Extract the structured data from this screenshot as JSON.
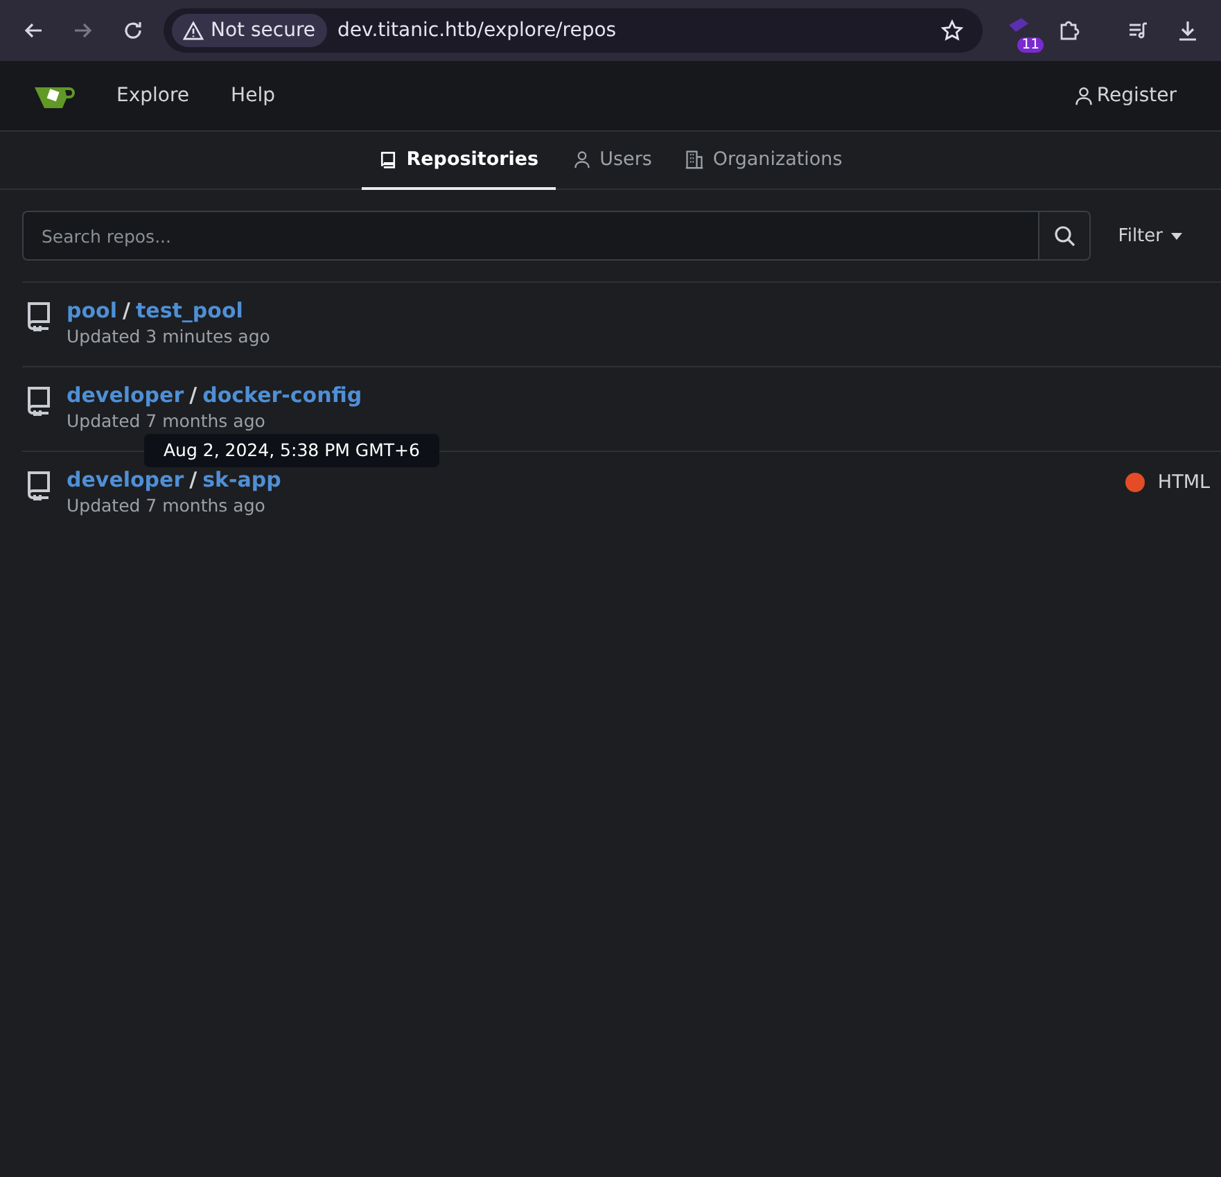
{
  "browser": {
    "security": "Not secure",
    "url": "dev.titanic.htb/explore/repos",
    "extension_badge": "11"
  },
  "nav": {
    "items": [
      "Explore",
      "Help"
    ],
    "register": "Register"
  },
  "tabs": [
    {
      "label": "Repositories",
      "kind": "repo",
      "selected": true
    },
    {
      "label": "Users",
      "kind": "user",
      "selected": false
    },
    {
      "label": "Organizations",
      "kind": "org",
      "selected": false
    }
  ],
  "search": {
    "placeholder": "Search repos...",
    "filter": "Filter"
  },
  "repos": [
    {
      "owner": "pool",
      "separator": "/",
      "name": "test_pool",
      "updated": "Updated 3 minutes ago"
    },
    {
      "owner": "developer",
      "separator": "/",
      "name": "docker-config",
      "updated": "Updated 7 months ago"
    },
    {
      "owner": "developer",
      "separator": "/",
      "name": "sk-app",
      "updated": "Updated 7 months ago",
      "language": "HTML",
      "color": "#e34c26"
    }
  ],
  "tooltip": {
    "text": "Aug 2, 2024, 5:38 PM GMT+6"
  }
}
